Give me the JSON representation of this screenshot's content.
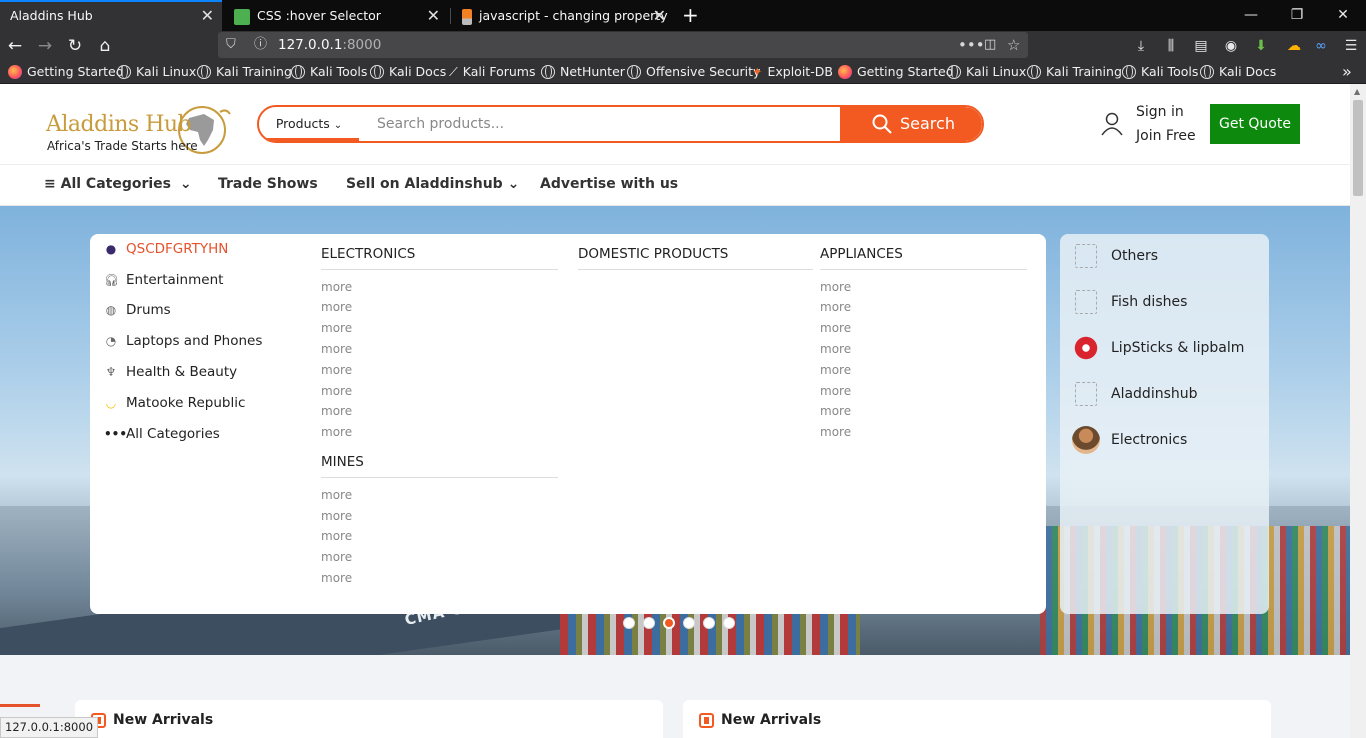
{
  "browser": {
    "tabs": [
      {
        "title": "Aladdins Hub",
        "active": true
      },
      {
        "title": "CSS :hover Selector",
        "active": false
      },
      {
        "title": "javascript - changing property",
        "active": false
      }
    ],
    "url_host": "127.0.0.1",
    "url_port": ":8000",
    "bookmarks": [
      "Getting Started",
      "Kali Linux",
      "Kali Training",
      "Kali Tools",
      "Kali Docs",
      "Kali Forums",
      "NetHunter",
      "Offensive Security",
      "Exploit-DB",
      "Getting Started",
      "Kali Linux",
      "Kali Training",
      "Kali Tools",
      "Kali Docs"
    ],
    "status_url": "127.0.0.1:8000"
  },
  "header": {
    "logo_title": "Aladdins Hub",
    "logo_tagline": "Africa's Trade Starts here",
    "products_dropdown": "Products",
    "search_placeholder": "Search products...",
    "search_button": "Search",
    "sign_in": "Sign in",
    "join_free": "Join Free",
    "get_quote": "Get Quote"
  },
  "nav": {
    "all_categories": "All Categories",
    "trade_shows": "Trade Shows",
    "sell": "Sell on Aladdinshub",
    "advertise": "Advertise with us"
  },
  "categories": [
    {
      "label": "QSCDFGRTYHN",
      "icon": "category-logo-icon"
    },
    {
      "label": "Entertainment",
      "icon": "headphones-icon"
    },
    {
      "label": "Drums",
      "icon": "drum-icon"
    },
    {
      "label": "Laptops and Phones",
      "icon": "apple-icon"
    },
    {
      "label": "Health & Beauty",
      "icon": "beauty-icon"
    },
    {
      "label": "Matooke Republic",
      "icon": "banana-icon"
    },
    {
      "label": "All Categories",
      "icon": "more-dots-icon"
    }
  ],
  "megamenu": {
    "electronics": {
      "title": "ELECTRONICS",
      "links": [
        "more",
        "more",
        "more",
        "more",
        "more",
        "more",
        "more",
        "more"
      ]
    },
    "domestic": {
      "title": "DOMESTIC PRODUCTS",
      "links": []
    },
    "appliances": {
      "title": "APPLIANCES",
      "links": [
        "more",
        "more",
        "more",
        "more",
        "more",
        "more",
        "more",
        "more"
      ]
    },
    "mines": {
      "title": "MINES",
      "links": [
        "more",
        "more",
        "more",
        "more",
        "more"
      ]
    }
  },
  "right_panel": [
    {
      "label": "Others",
      "icon": "broken-image-icon"
    },
    {
      "label": "Fish dishes",
      "icon": "broken-image-icon"
    },
    {
      "label": "LipSticks & lipbalm",
      "icon": "lips-icon"
    },
    {
      "label": "Aladdinshub",
      "icon": "broken-image-icon"
    },
    {
      "label": "Electronics",
      "icon": "person-thumb-icon"
    }
  ],
  "carousel": {
    "slide_count": 6,
    "active_index": 2
  },
  "hero_text": "CMA CGM",
  "sections": [
    {
      "title": "New Arrivals"
    },
    {
      "title": "New Arrivals"
    }
  ],
  "colors": {
    "accent": "#f25a22",
    "quote_green": "#0d8a0d",
    "active_category": "#e5532d"
  }
}
